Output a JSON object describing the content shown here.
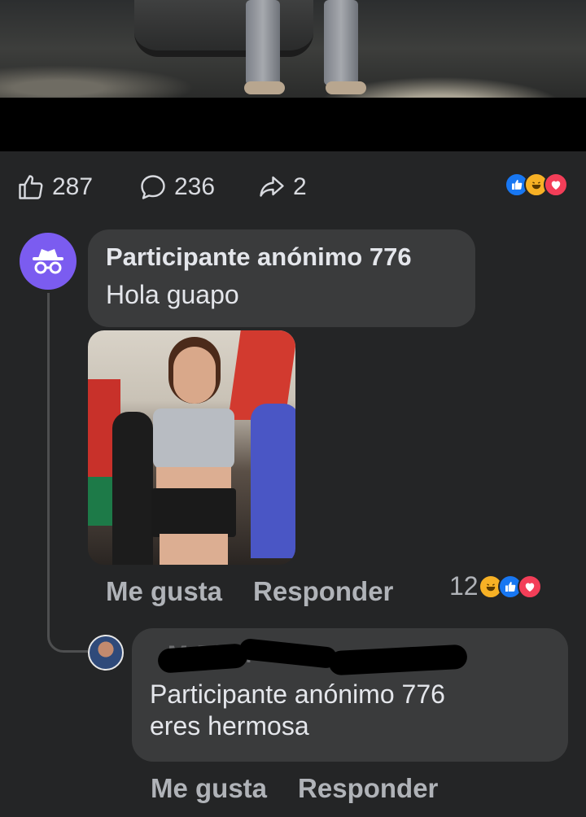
{
  "post": {
    "stats": {
      "likes": "287",
      "comments": "236",
      "shares": "2"
    },
    "reaction_icons": [
      "like-icon",
      "haha-icon",
      "love-icon"
    ]
  },
  "comments": [
    {
      "author": "Participante anónimo 776",
      "text": "Hola guapo",
      "avatar_icon": "incognito-icon",
      "has_photo": true,
      "actions": {
        "like": "Me gusta",
        "reply": "Responder"
      },
      "reaction_count": "12",
      "reaction_icons": [
        "haha-icon",
        "like-icon",
        "love-icon"
      ],
      "replies": [
        {
          "author_redacted": true,
          "text_lines": [
            "Participante anónimo 776",
            "eres hermosa"
          ],
          "actions": {
            "like": "Me gusta",
            "reply": "Responder"
          }
        }
      ]
    }
  ],
  "colors": {
    "background": "#242526",
    "bubble": "#3a3b3c",
    "anon_avatar": "#7b5cf0",
    "like_blue": "#1877f2",
    "haha_yellow": "#f7b125",
    "love_red": "#f33e58",
    "secondary_text": "#b0b3b8"
  }
}
